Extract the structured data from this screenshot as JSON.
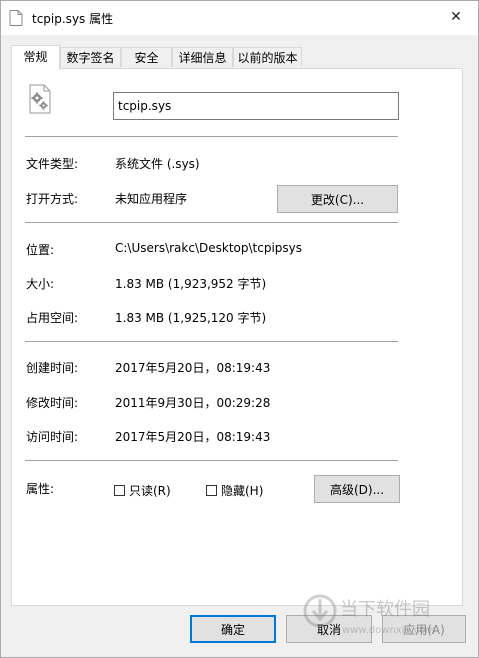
{
  "window": {
    "title": "tcpip.sys 属性",
    "close_glyph": "✕"
  },
  "tabs": [
    {
      "label": "常规",
      "active": true
    },
    {
      "label": "数字签名",
      "active": false
    },
    {
      "label": "安全",
      "active": false
    },
    {
      "label": "详细信息",
      "active": false
    },
    {
      "label": "以前的版本",
      "active": false
    }
  ],
  "general": {
    "file_name": "tcpip.sys",
    "type_label": "文件类型:",
    "type_value": "系统文件 (.sys)",
    "opens_with_label": "打开方式:",
    "opens_with_value": "未知应用程序",
    "change_button": "更改(C)...",
    "location_label": "位置:",
    "location_value": "C:\\Users\\rakc\\Desktop\\tcpipsys",
    "size_label": "大小:",
    "size_value": "1.83 MB (1,923,952 字节)",
    "size_on_disk_label": "占用空间:",
    "size_on_disk_value": "1.83 MB (1,925,120 字节)",
    "created_label": "创建时间:",
    "created_value": "2017年5月20日，08:19:43",
    "modified_label": "修改时间:",
    "modified_value": "2011年9月30日，00:29:28",
    "accessed_label": "访问时间:",
    "accessed_value": "2017年5月20日，08:19:43",
    "attributes_label": "属性:",
    "readonly_label": "只读(R)",
    "readonly_checked": false,
    "hidden_label": "隐藏(H)",
    "hidden_checked": false,
    "advanced_button": "高级(D)..."
  },
  "footer": {
    "ok_button": "确定",
    "cancel_button": "取消",
    "apply_button": "应用(A)"
  },
  "watermark": {
    "text": "当下软件园",
    "url": "www.downxia.com"
  },
  "colors": {
    "accent": "#0078d7",
    "window_bg": "#f0f0f0",
    "panel_bg": "#ffffff"
  }
}
